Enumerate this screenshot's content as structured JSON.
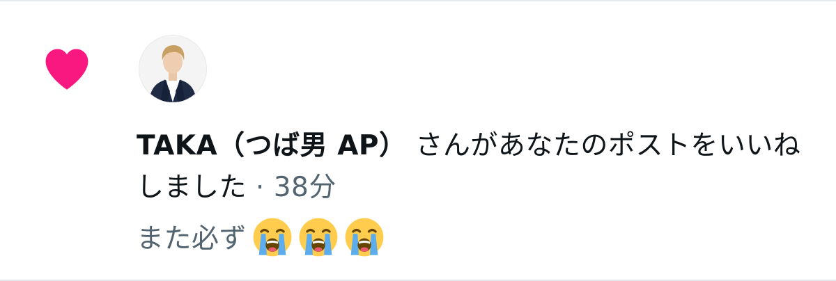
{
  "notification": {
    "type_icon": "heart-icon",
    "icon_color": "#f91880",
    "actor": {
      "name": "TAKA（つば男 AP）",
      "avatar": "avatar"
    },
    "action_text": " さんがあなたのポストをいいねしました",
    "separator": " · ",
    "time_ago": "38分",
    "post_excerpt": "また必ず",
    "post_emojis": [
      "loudly-crying-face",
      "loudly-crying-face",
      "loudly-crying-face"
    ]
  },
  "colors": {
    "primary_text": "#0f1419",
    "secondary_text": "#536471",
    "divider": "#e6e9ec"
  }
}
